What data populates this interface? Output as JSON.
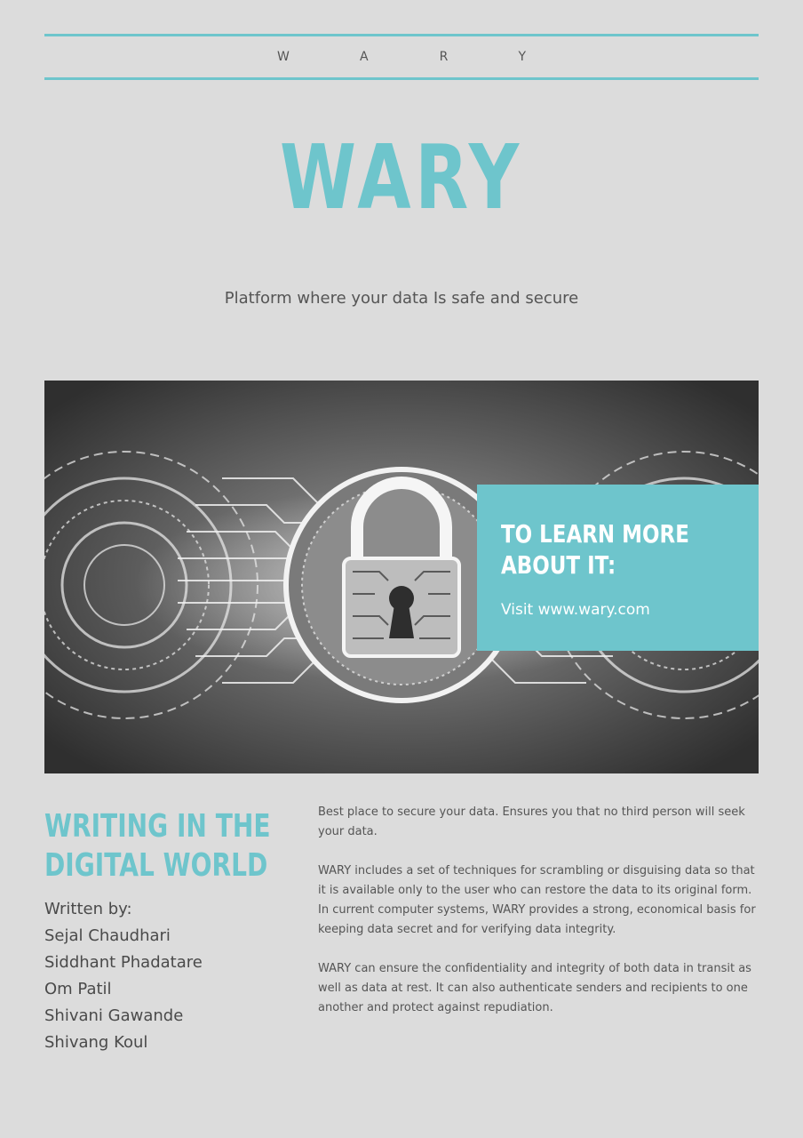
{
  "masthead": {
    "letters": "WARY"
  },
  "title": "WARY",
  "tagline": "Platform where your data Is safe and secure",
  "hero": {
    "image": "cybersecurity-padlock-circuit-image"
  },
  "callout": {
    "title_line1": "TO LEARN MORE",
    "title_line2": "ABOUT IT:",
    "link": "Visit www.wary.com"
  },
  "section": {
    "title_line1": "WRITING IN THE",
    "title_line2": "DIGITAL WORLD"
  },
  "authors": {
    "label": "Written by:",
    "names": [
      "Sejal Chaudhari",
      "Siddhant Phadatare",
      "Om Patil",
      "Shivani Gawande",
      "Shivang Koul"
    ]
  },
  "body": {
    "paragraphs": [
      "Best place to secure your data. Ensures you that no third person will seek your data.",
      "WARY includes a set of techniques for scrambling or disguising data so that it is available only to the user who can restore the data to its original form. In current computer systems, WARY provides a strong, economical basis for keeping data secret and for verifying data integrity.",
      "WARY can ensure the confidentiality and integrity of both data in transit as well as data at rest. It can also authenticate senders and recipients to one another and protect against repudiation."
    ]
  },
  "colors": {
    "accent": "#6ec5cc",
    "background": "#dcdcdc",
    "text": "#4a4a4a"
  }
}
